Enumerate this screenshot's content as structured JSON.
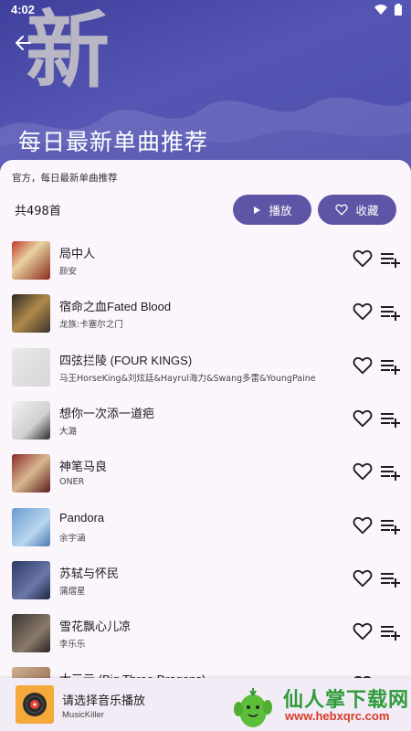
{
  "status": {
    "time": "4:02"
  },
  "header": {
    "big_char": "新",
    "title": "每日最新单曲推荐"
  },
  "sheet": {
    "subtitle": "官方，每日最新单曲推荐",
    "count": "共498首",
    "play_label": "播放",
    "fav_label": "收藏"
  },
  "songs": [
    {
      "title": "局中人",
      "artist": "颜安"
    },
    {
      "title": "宿命之血Fated Blood",
      "artist": "龙族:卡塞尔之门"
    },
    {
      "title": "四弦拦陵 (FOUR KINGS)",
      "artist": "马王HorseKing&刘炫廷&Hayrul海力&Swang多雷&YoungPaine"
    },
    {
      "title": "想你一次添一道疤",
      "artist": "大潞"
    },
    {
      "title": "神笔马良",
      "artist": "ONER"
    },
    {
      "title": "Pandora",
      "artist": "余宇涵"
    },
    {
      "title": "苏轼与怀民",
      "artist": "蒲熠星"
    },
    {
      "title": "雪花飘心儿凉",
      "artist": "李乐乐"
    },
    {
      "title": "大三元 (Big Three Dragons)",
      "artist": ""
    }
  ],
  "player": {
    "title": "请选择音乐播放",
    "subtitle": "MusicKiller"
  },
  "watermark": {
    "text": "仙人掌下载网",
    "url": "www.hebxqrc.com"
  },
  "colors": {
    "header_bg": "#4b4aa8",
    "accent_button": "#5f55a6",
    "sheet_bg": "#fbf6fc"
  }
}
